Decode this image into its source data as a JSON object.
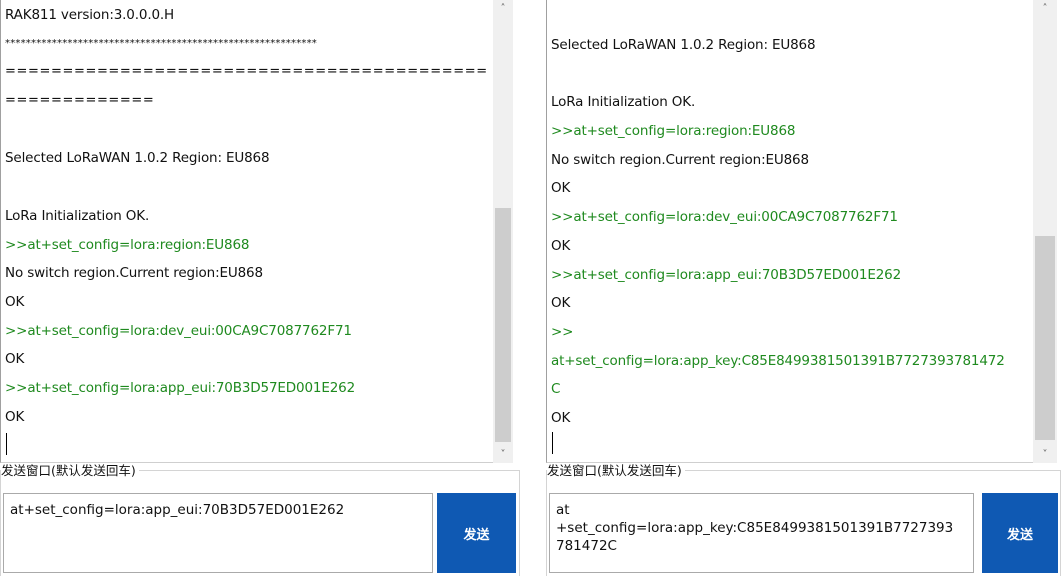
{
  "left": {
    "lines": [
      {
        "text": "RAK811 version:3.0.0.0.H",
        "type": "plain"
      },
      {
        "text": "************************************************************",
        "type": "stars"
      },
      {
        "text": "==========================================",
        "type": "eq"
      },
      {
        "text": "=============",
        "type": "eq"
      },
      {
        "text": "",
        "type": "plain"
      },
      {
        "text": "Selected LoRaWAN 1.0.2 Region: EU868",
        "type": "plain"
      },
      {
        "text": "",
        "type": "plain"
      },
      {
        "text": "LoRa Initialization OK.",
        "type": "plain"
      },
      {
        "text": ">>at+set_config=lora:region:EU868",
        "type": "cmd"
      },
      {
        "text": "No switch region.Current region:EU868",
        "type": "plain"
      },
      {
        "text": "OK",
        "type": "plain"
      },
      {
        "text": ">>at+set_config=lora:dev_eui:00CA9C7087762F71",
        "type": "cmd"
      },
      {
        "text": "OK",
        "type": "plain"
      },
      {
        "text": ">>at+set_config=lora:app_eui:70B3D57ED001E262",
        "type": "cmd"
      },
      {
        "text": "OK",
        "type": "plain"
      }
    ],
    "send_label": "发送窗口(默认发送回车)",
    "send_value": "at+set_config=lora:app_eui:70B3D57ED001E262",
    "send_button": "发送"
  },
  "right": {
    "lines": [
      {
        "text": "Selected LoRaWAN 1.0.2 Region: EU868",
        "type": "plain"
      },
      {
        "text": "",
        "type": "plain"
      },
      {
        "text": "LoRa Initialization OK.",
        "type": "plain"
      },
      {
        "text": ">>at+set_config=lora:region:EU868",
        "type": "cmd"
      },
      {
        "text": "No switch region.Current region:EU868",
        "type": "plain"
      },
      {
        "text": "OK",
        "type": "plain"
      },
      {
        "text": ">>at+set_config=lora:dev_eui:00CA9C7087762F71",
        "type": "cmd"
      },
      {
        "text": "OK",
        "type": "plain"
      },
      {
        "text": ">>at+set_config=lora:app_eui:70B3D57ED001E262",
        "type": "cmd"
      },
      {
        "text": "OK",
        "type": "plain"
      },
      {
        "text": ">>",
        "type": "cmd"
      },
      {
        "text": "at+set_config=lora:app_key:C85E8499381501391B7727393781472",
        "type": "cmd"
      },
      {
        "text": "C",
        "type": "cmd"
      },
      {
        "text": "OK",
        "type": "plain"
      }
    ],
    "send_label": "发送窗口(默认发送回车)",
    "send_value": "at\n+set_config=lora:app_key:C85E8499381501391B7727393\n781472C",
    "send_button": "发送"
  },
  "icons": {
    "scroll_up": "chevron-up-icon",
    "scroll_down": "chevron-down-icon"
  },
  "colors": {
    "command_text": "#1f8a1f",
    "send_button": "#0f59b3"
  }
}
